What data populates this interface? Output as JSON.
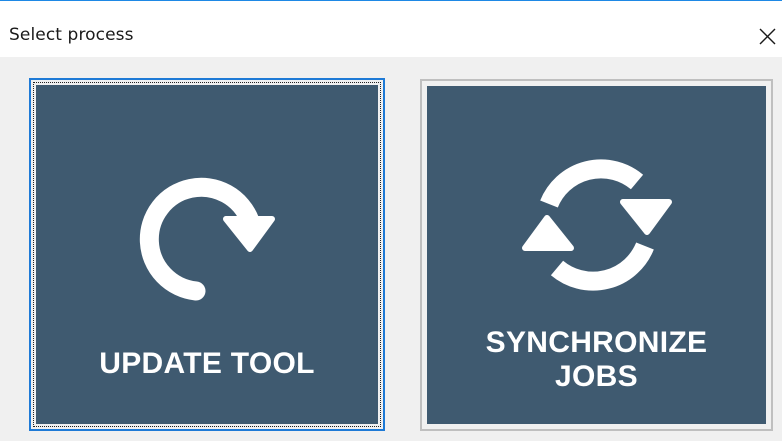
{
  "window": {
    "title": "Select process",
    "close_icon": "close-x-icon"
  },
  "tiles": [
    {
      "label": "UPDATE TOOL",
      "icon": "refresh-clockwise-icon",
      "focused": true
    },
    {
      "label": "SYNCHRONIZE\nJOBS",
      "icon": "sync-arrows-icon",
      "focused": false
    }
  ],
  "colors": {
    "tile_background": "#3f5a70",
    "focus_border": "#1e7ad6",
    "window_background": "#f0f0f0"
  }
}
